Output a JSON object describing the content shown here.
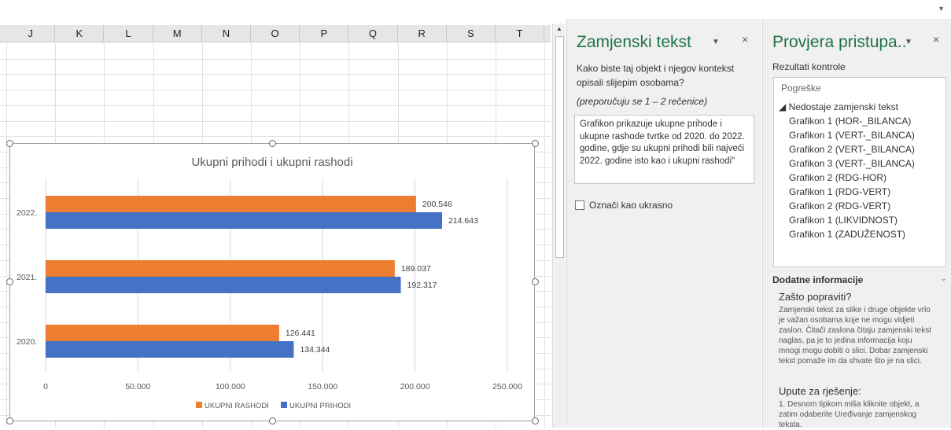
{
  "spreadsheet": {
    "columns": [
      "J",
      "K",
      "L",
      "M",
      "N",
      "O",
      "P",
      "Q",
      "R",
      "S",
      "T"
    ]
  },
  "chart_data": {
    "type": "bar",
    "orientation": "horizontal",
    "title": "Ukupni prihodi i ukupni rashodi",
    "categories": [
      "2022.",
      "2021.",
      "2020."
    ],
    "series": [
      {
        "name": "UKUPNI RASHODI",
        "color": "#ED7D31",
        "values": [
          200546,
          189037,
          126441
        ],
        "labels": [
          "200.546",
          "189.037",
          "126.441"
        ]
      },
      {
        "name": "UKUPNI PRIHODI",
        "color": "#4472C4",
        "values": [
          214643,
          192317,
          134344
        ],
        "labels": [
          "214.643",
          "192.317",
          "134.344"
        ]
      }
    ],
    "xlim": [
      0,
      250000
    ],
    "xticks": [
      0,
      50000,
      100000,
      150000,
      200000,
      250000
    ],
    "xtick_labels": [
      "0",
      "50.000",
      "100.000",
      "150.000",
      "200.000",
      "250.000"
    ],
    "grid": true,
    "legend": "bottom"
  },
  "alt_text_pane": {
    "title": "Zamjenski tekst",
    "dropdown_icon": "chevron-down-icon",
    "close_label": "×",
    "question": [
      "Kako biste taj objekt i njegov kontekst",
      "opisali slijepim osobama?"
    ],
    "hint": "(preporučuju se 1 – 2 rečenice)",
    "alt_text_lines": [
      "Grafikon prikazuje ukupne prihode i",
      "ukupne rashode tvrtke od 2020. do 2022.",
      "godine, gdje su ukupni prihodi bili najveći",
      "2022. godine isto kao i ukupni rashodi\""
    ],
    "decorative_label": "Označi kao ukrasno"
  },
  "accessibility_pane": {
    "title": "Provjera pristupa..",
    "close_label": "×",
    "results_label": "Rezultati kontrole",
    "errors_header": "Pogreške",
    "error_group": "◢ Nedostaje zamjenski tekst",
    "error_items": [
      "Grafikon 1 (HOR-_BILANCA)",
      "Grafikon 1 (VERT-_BILANCA)",
      "Grafikon 2 (VERT-_BILANCA)",
      "Grafikon 3 (VERT-_BILANCA)",
      "Grafikon 2 (RDG-HOR)",
      "Grafikon 1 (RDG-VERT)",
      "Grafikon 2 (RDG-VERT)",
      "Grafikon 1 (LIKVIDNOST)",
      "Grafikon 1 (ZADUŽENOST)"
    ],
    "info_header": "Dodatne informacije",
    "why_title": "Zašto popraviti?",
    "why_lines": [
      "Zamjenski tekst za slike i druge objekte vrlo",
      "je važan osobama koje ne mogu vidjeti",
      "zaslon. Čitači zaslona čitaju zamjenski tekst",
      "naglas, pa je to jedina informacija koju",
      "mnogi mogu dobiti o slici. Dobar zamjenski",
      "tekst pomaže im da shvate što je na slici."
    ],
    "fix_title": "Upute za rješenje:",
    "fix_lines": [
      "1. Desnom tipkom miša kliknite objekt, a",
      "zatim odaberite Uređivanje zamjenskog",
      "teksta."
    ]
  }
}
